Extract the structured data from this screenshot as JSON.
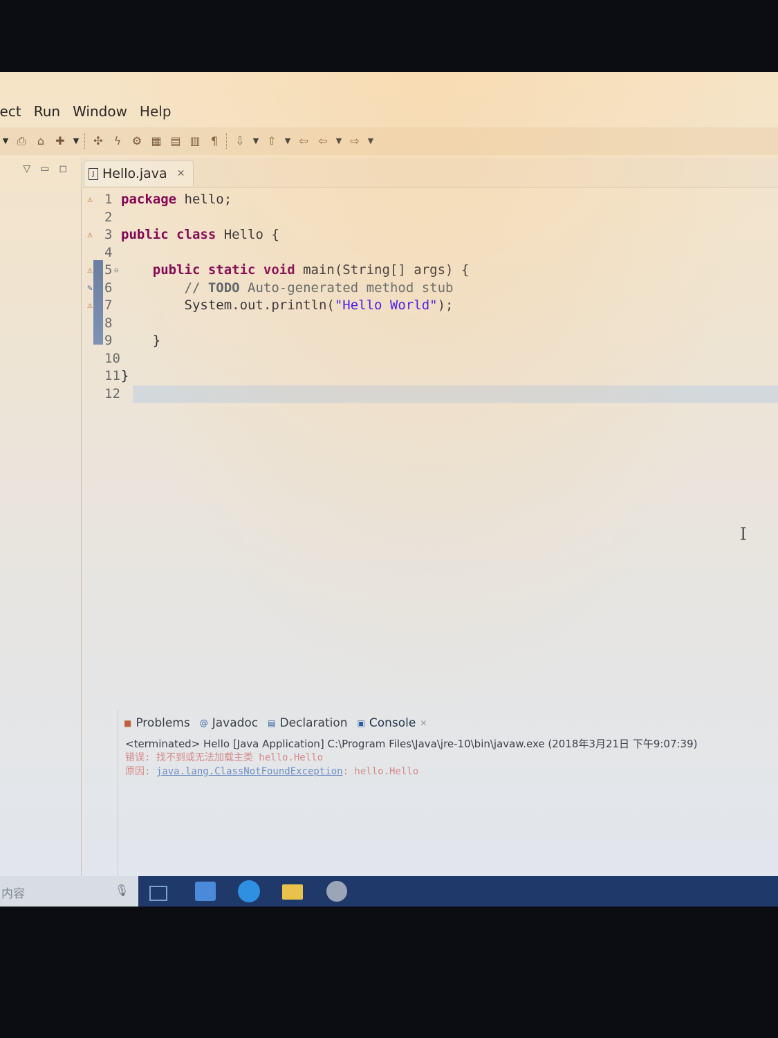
{
  "menu": [
    "ject",
    "Run",
    "Window",
    "Help"
  ],
  "toolbar": {
    "icons": [
      "new-icon",
      "open-icon",
      "save-icon",
      "debug-icon",
      "run-icon",
      "external-tools-icon",
      "new-class-icon",
      "search-icon",
      "annotation-icon",
      "pilcrow-icon",
      "next-annotation-icon",
      "prev-annotation-icon",
      "last-edit-icon",
      "back-icon",
      "forward-icon"
    ]
  },
  "left_panel": {
    "controls": [
      "view-menu-icon",
      "minimize-icon",
      "maximize-icon"
    ]
  },
  "editor": {
    "tab_title": "Hello.java",
    "lines": [
      {
        "n": "1",
        "marker": "warning",
        "segments": [
          {
            "t": "package",
            "c": "kw"
          },
          {
            "t": " hello;",
            "c": ""
          }
        ]
      },
      {
        "n": "2",
        "marker": "",
        "segments": []
      },
      {
        "n": "3",
        "marker": "warning",
        "segments": [
          {
            "t": "public class",
            "c": "kw"
          },
          {
            "t": " Hello {",
            "c": ""
          }
        ]
      },
      {
        "n": "4",
        "marker": "",
        "segments": []
      },
      {
        "n": "5",
        "marker": "warning",
        "fold": "⊖",
        "segments": [
          {
            "t": "    public static void",
            "c": "kw"
          },
          {
            "t": " main(String[] args) {",
            "c": ""
          }
        ]
      },
      {
        "n": "6",
        "marker": "task",
        "segments": [
          {
            "t": "        // ",
            "c": "cmt"
          },
          {
            "t": "TODO",
            "c": "todo"
          },
          {
            "t": " Auto-generated method stub",
            "c": "cmt"
          }
        ]
      },
      {
        "n": "7",
        "marker": "warning",
        "segments": [
          {
            "t": "        System.out.println(",
            "c": ""
          },
          {
            "t": "\"Hello World\"",
            "c": "str"
          },
          {
            "t": ");",
            "c": ""
          }
        ]
      },
      {
        "n": "8",
        "marker": "",
        "segments": []
      },
      {
        "n": "9",
        "marker": "",
        "segments": [
          {
            "t": "    }",
            "c": ""
          }
        ]
      },
      {
        "n": "10",
        "marker": "",
        "segments": []
      },
      {
        "n": "11",
        "marker": "",
        "segments": [
          {
            "t": "}",
            "c": ""
          }
        ]
      },
      {
        "n": "12",
        "marker": "",
        "current": true,
        "segments": []
      }
    ]
  },
  "console": {
    "tabs": [
      {
        "label": "Problems",
        "icon": "problems-icon"
      },
      {
        "label": "Javadoc",
        "icon": "javadoc-icon"
      },
      {
        "label": "Declaration",
        "icon": "declaration-icon"
      },
      {
        "label": "Console",
        "icon": "console-icon",
        "active": true
      }
    ],
    "terminated": "<terminated> Hello [Java Application] C:\\Program Files\\Java\\jre-10\\bin\\javaw.exe (2018年3月21日 下午9:07:39)",
    "error_line1": "错误: 找不到或无法加载主类 hello.Hello",
    "error_line2_prefix": "原因: ",
    "error_line2_link": "java.lang.ClassNotFoundException",
    "error_line2_suffix": ": hello.Hello"
  },
  "taskbar": {
    "search_text": "内容",
    "apps": [
      "task-view-icon",
      "store-icon",
      "edge-icon",
      "file-explorer-icon",
      "eclipse-icon"
    ]
  },
  "colors": {
    "keyword": "#7f0055",
    "string": "#2a00ff",
    "comment": "#555f6a",
    "error": "#d68a8a",
    "taskbar": "#1f3a6a"
  }
}
